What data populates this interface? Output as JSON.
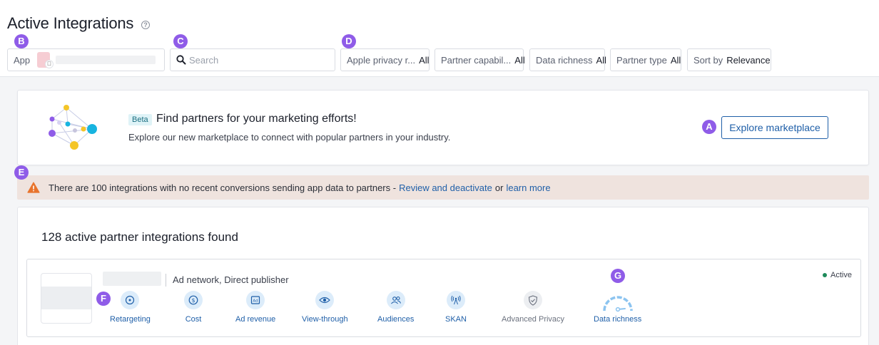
{
  "header": {
    "title": "Active Integrations",
    "help_icon": "question-circle-icon"
  },
  "markers": {
    "a": "A",
    "b": "B",
    "c": "C",
    "d": "D",
    "e": "E",
    "f": "F",
    "g": "G"
  },
  "filters": {
    "app": {
      "label": "App"
    },
    "search": {
      "placeholder": "Search"
    },
    "apple_privacy": {
      "label": "Apple privacy r...",
      "value": "All"
    },
    "partner_capability": {
      "label": "Partner capabil...",
      "value": "All"
    },
    "data_richness": {
      "label": "Data richness",
      "value": "All"
    },
    "partner_type": {
      "label": "Partner type",
      "value": "All"
    },
    "sort_by": {
      "label": "Sort by",
      "value": "Relevance"
    }
  },
  "promo": {
    "badge": "Beta",
    "title": "Find partners for your marketing efforts!",
    "description": "Explore our new marketplace to connect with popular partners in your industry.",
    "button": "Explore marketplace"
  },
  "warning": {
    "text": "There are 100 integrations with no recent conversions sending app data to partners -",
    "link1": "Review and deactivate",
    "connector": "or",
    "link2": "learn more"
  },
  "results": {
    "title": "128 active partner integrations found",
    "partner": {
      "types": "Ad network, Direct publisher",
      "status": "Active",
      "status_color": "#1e8a5a",
      "capabilities": [
        {
          "label": "Retargeting",
          "icon": "retargeting-icon"
        },
        {
          "label": "Cost",
          "icon": "dollar-icon"
        },
        {
          "label": "Ad revenue",
          "icon": "ad-icon"
        },
        {
          "label": "View-through",
          "icon": "eye-icon"
        },
        {
          "label": "Audiences",
          "icon": "audiences-icon"
        },
        {
          "label": "SKAN",
          "icon": "antenna-icon"
        },
        {
          "label": "Advanced Privacy",
          "icon": "shield-icon"
        },
        {
          "label": "Data richness",
          "icon": "gauge-icon"
        }
      ]
    }
  },
  "colors": {
    "accent": "#1f5fa8",
    "marker": "#8f5ce8",
    "warning_bg": "#efe3de",
    "warning_icon": "#e8732c"
  }
}
